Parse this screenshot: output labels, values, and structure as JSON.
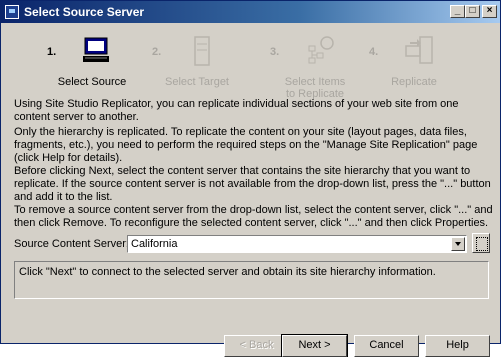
{
  "window": {
    "title": "Select Source Server"
  },
  "steps": [
    {
      "number": "1.",
      "label": "Select Source",
      "icon": "computer-icon",
      "active": true
    },
    {
      "number": "2.",
      "label": "Select Target",
      "icon": "server-icon",
      "active": false
    },
    {
      "number": "3.",
      "label": "Select Items\nto Replicate",
      "icon": "items-icon",
      "active": false
    },
    {
      "number": "4.",
      "label": "Replicate",
      "icon": "replicate-icon",
      "active": false
    }
  ],
  "text": {
    "intro": "Using Site Studio Replicator, you can replicate individual sections of your web site from one content server to another.",
    "hierarchy": "Only the hierarchy is replicated.  To replicate the content on your site (layout pages, data files, fragments, etc.), you need to perform the required steps on the \"Manage Site Replication\" page (click Help for details).",
    "before_next": "Before clicking Next, select the content server  that contains the site hierarchy that you want to replicate.  If the source content server is not available from the drop-down list, press the \"...\" button and add it to the list.",
    "remove": "To remove a source content server from the drop-down list, select the content server, click \"...\" and then click Remove.  To reconfigure the selected content server, click \"...\" and then click Properties."
  },
  "source_server": {
    "label": "Source Content Server:",
    "value": "California"
  },
  "status": {
    "text": "Click \"Next\" to connect to the selected server and obtain its site hierarchy information."
  },
  "buttons": {
    "back": "< Back",
    "next": "Next >",
    "cancel": "Cancel",
    "help": "Help"
  },
  "colors": {
    "titlebar_start": "#0a246a",
    "titlebar_end": "#a6caf0",
    "dialog_bg": "#d4d0c8",
    "disabled_text": "#a9a6a0"
  }
}
